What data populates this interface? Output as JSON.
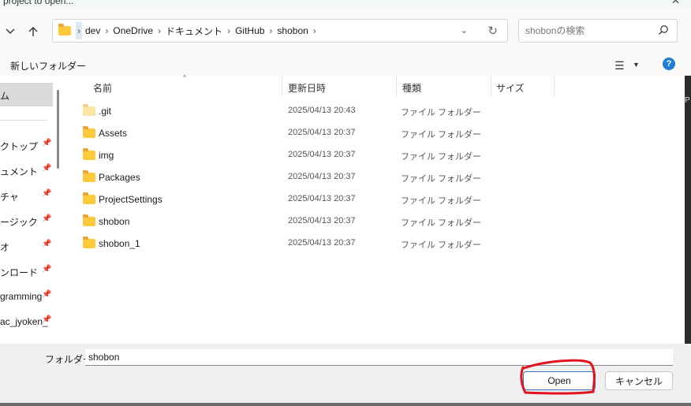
{
  "window": {
    "title": "project to open...",
    "close_glyph": "✕"
  },
  "nav": {
    "back_icon": "chevron-down-icon",
    "up_icon": "arrow-up-icon"
  },
  "address": {
    "crumbs": [
      "dev",
      "OneDrive",
      "ドキュメント",
      "GitHub",
      "shobon"
    ],
    "separator": "›",
    "dropdown_glyph": "⌄",
    "refresh_glyph": "↻"
  },
  "search": {
    "placeholder": "shobonの検索"
  },
  "toolbar": {
    "new_folder_label": "新しいフォルダー",
    "view_glyph": "☰",
    "view_caret": "▼",
    "help_glyph": "?"
  },
  "sidebar": {
    "selected_label": "ム",
    "pin_glyph": "📌",
    "items": [
      {
        "label": "クトップ"
      },
      {
        "label": "ュメント"
      },
      {
        "label": "チャ"
      },
      {
        "label": "ージック"
      },
      {
        "label": "オ"
      },
      {
        "label": "ンロード"
      },
      {
        "label": "gramming"
      },
      {
        "label": "ac_jyoken_"
      }
    ]
  },
  "columns": {
    "name": "名前",
    "date": "更新日時",
    "type": "種類",
    "size": "サイズ",
    "sort_glyph": "^"
  },
  "files": [
    {
      "name": ".git",
      "date": "2025/04/13 20:43",
      "type": "ファイル フォルダー",
      "hidden": true
    },
    {
      "name": "Assets",
      "date": "2025/04/13 20:37",
      "type": "ファイル フォルダー",
      "hidden": false
    },
    {
      "name": "img",
      "date": "2025/04/13 20:37",
      "type": "ファイル フォルダー",
      "hidden": false
    },
    {
      "name": "Packages",
      "date": "2025/04/13 20:37",
      "type": "ファイル フォルダー",
      "hidden": false
    },
    {
      "name": "ProjectSettings",
      "date": "2025/04/13 20:37",
      "type": "ファイル フォルダー",
      "hidden": false
    },
    {
      "name": "shobon",
      "date": "2025/04/13 20:37",
      "type": "ファイル フォルダー",
      "hidden": false
    },
    {
      "name": "shobon_1",
      "date": "2025/04/13 20:37",
      "type": "ファイル フォルダー",
      "hidden": false
    }
  ],
  "background_window": {
    "fragment": "P"
  },
  "footer": {
    "folder_label": "フォルダー:",
    "folder_value": "shobon",
    "open_label": "Open",
    "cancel_label": "キャンセル"
  },
  "colors": {
    "accent": "#1f7ed4",
    "folder": "#ffc83d",
    "annotation": "#e0141a"
  }
}
